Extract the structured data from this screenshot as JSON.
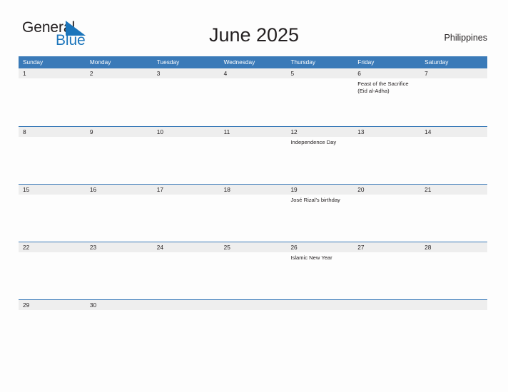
{
  "brand": {
    "name_part1": "General",
    "name_part2": "Blue",
    "triangle_color": "#1b75bb",
    "text_color": "#231f20"
  },
  "header": {
    "title": "June 2025",
    "country": "Philippines"
  },
  "theme": {
    "header_blue": "#3a7ab8",
    "rail_gray": "#eeeeee",
    "page_background": "#fdfdfd",
    "text_color": "#231f20",
    "separator_blue": "#3a7ab8"
  },
  "weekdays": [
    "Sunday",
    "Monday",
    "Tuesday",
    "Wednesday",
    "Thursday",
    "Friday",
    "Saturday"
  ],
  "weeks": [
    {
      "days": [
        {
          "date": "1",
          "events": []
        },
        {
          "date": "2",
          "events": []
        },
        {
          "date": "3",
          "events": []
        },
        {
          "date": "4",
          "events": []
        },
        {
          "date": "5",
          "events": []
        },
        {
          "date": "6",
          "events": [
            "Feast of the Sacrifice (Eid al-Adha)"
          ]
        },
        {
          "date": "7",
          "events": []
        }
      ]
    },
    {
      "days": [
        {
          "date": "8",
          "events": []
        },
        {
          "date": "9",
          "events": []
        },
        {
          "date": "10",
          "events": []
        },
        {
          "date": "11",
          "events": []
        },
        {
          "date": "12",
          "events": [
            "Independence Day"
          ]
        },
        {
          "date": "13",
          "events": []
        },
        {
          "date": "14",
          "events": []
        }
      ]
    },
    {
      "days": [
        {
          "date": "15",
          "events": []
        },
        {
          "date": "16",
          "events": []
        },
        {
          "date": "17",
          "events": []
        },
        {
          "date": "18",
          "events": []
        },
        {
          "date": "19",
          "events": [
            "José Rizal's birthday"
          ]
        },
        {
          "date": "20",
          "events": []
        },
        {
          "date": "21",
          "events": []
        }
      ]
    },
    {
      "days": [
        {
          "date": "22",
          "events": []
        },
        {
          "date": "23",
          "events": []
        },
        {
          "date": "24",
          "events": []
        },
        {
          "date": "25",
          "events": []
        },
        {
          "date": "26",
          "events": [
            "Islamic New Year"
          ]
        },
        {
          "date": "27",
          "events": []
        },
        {
          "date": "28",
          "events": []
        }
      ]
    },
    {
      "days": [
        {
          "date": "29",
          "events": []
        },
        {
          "date": "30",
          "events": []
        },
        {
          "date": "",
          "events": []
        },
        {
          "date": "",
          "events": []
        },
        {
          "date": "",
          "events": []
        },
        {
          "date": "",
          "events": []
        },
        {
          "date": "",
          "events": []
        }
      ]
    }
  ]
}
